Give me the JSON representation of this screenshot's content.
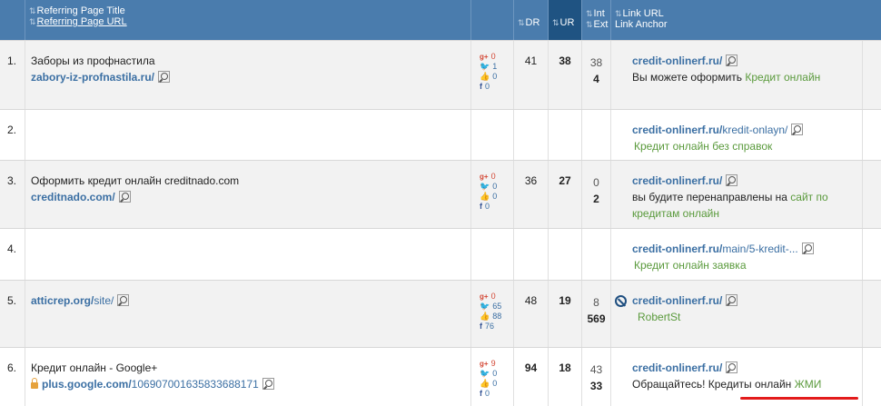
{
  "header": {
    "title_col_line1": "Referring Page Title",
    "title_col_line2": "Referring Page URL",
    "dr": "DR",
    "ur": "UR",
    "int": "Int",
    "ext": "Ext",
    "link_url": "Link URL",
    "link_anchor": "Link Anchor"
  },
  "rows": [
    {
      "num": "1.",
      "title": "Заборы из профнастила",
      "url_domain": "zabory-iz-profnastila.ru/",
      "url_path": "",
      "social": {
        "gplus": "0",
        "twitter": "1",
        "like": "0",
        "fb": "0"
      },
      "dr": "41",
      "ur": "38",
      "int": "38",
      "ext": "4",
      "link_domain": "credit-onlinerf.ru/",
      "link_path": "",
      "anchor_prefix": "Вы можете оформить ",
      "anchor_green": "Кредит онлайн"
    },
    {
      "num": "2.",
      "link_domain": "credit-onlinerf.ru/",
      "link_path": "kredit-onlayn/",
      "anchor_green": "Кредит онлайн без справок"
    },
    {
      "num": "3.",
      "title": "Оформить кредит онлайн creditnado.com",
      "url_domain": "creditnado.com/",
      "url_path": "",
      "social": {
        "gplus": "0",
        "twitter": "0",
        "like": "0",
        "fb": "0"
      },
      "dr": "36",
      "ur": "27",
      "int": "0",
      "ext": "2",
      "link_domain": "credit-onlinerf.ru/",
      "link_path": "",
      "anchor_prefix": "вы будите перенаправлены на ",
      "anchor_green": "сайт по кредитам онлайн"
    },
    {
      "num": "4.",
      "link_domain": "credit-onlinerf.ru/",
      "link_path": "main/5-kredit-...",
      "anchor_green": "Кредит онлайн заявка"
    },
    {
      "num": "5.",
      "title": "",
      "url_domain": "atticrep.org/",
      "url_path": "site/",
      "social": {
        "gplus": "0",
        "twitter": "65",
        "like": "88",
        "fb": "76"
      },
      "dr": "48",
      "ur": "19",
      "int": "8",
      "ext": "569",
      "link_domain": "credit-onlinerf.ru/",
      "link_path": "",
      "anchor_prefix": "",
      "anchor_green": "RobertSt"
    },
    {
      "num": "6.",
      "title": "Кредит онлайн - Google+",
      "url_domain": "plus.google.com/",
      "url_path": "106907001635833688171",
      "social": {
        "gplus": "9",
        "twitter": "0",
        "like": "0",
        "fb": "0"
      },
      "dr": "94",
      "ur": "18",
      "int": "43",
      "ext": "33",
      "link_domain": "credit-onlinerf.ru/",
      "link_path": "",
      "anchor_prefix": "Обращайтесь! Кредиты онлайн ",
      "anchor_green": "ЖМИ"
    }
  ]
}
